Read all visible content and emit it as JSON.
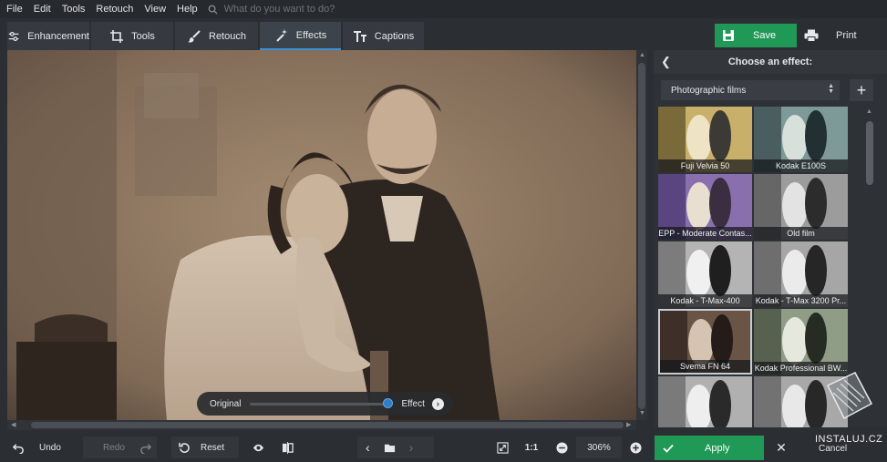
{
  "menu": {
    "items": [
      "File",
      "Edit",
      "Tools",
      "Retouch",
      "View",
      "Help"
    ],
    "search_placeholder": "What do you want to do?"
  },
  "tabs": [
    {
      "label": "Enhancement",
      "icon": "sliders-icon"
    },
    {
      "label": "Tools",
      "icon": "crop-icon"
    },
    {
      "label": "Retouch",
      "icon": "brush-icon"
    },
    {
      "label": "Effects",
      "icon": "magic-wand-icon",
      "active": true
    },
    {
      "label": "Captions",
      "icon": "text-icon"
    }
  ],
  "toolbar": {
    "save_label": "Save",
    "print_label": "Print"
  },
  "compare": {
    "original_label": "Original",
    "effect_label": "Effect",
    "slider_value": 1.0
  },
  "panel": {
    "title": "Choose an effect:",
    "category": "Photographic films",
    "effects": [
      {
        "label": "Fuji Velvia 50"
      },
      {
        "label": "Kodak E100S"
      },
      {
        "label": "EPP - Moderate Contas..."
      },
      {
        "label": "Old film"
      },
      {
        "label": "Kodak - T-Max-400"
      },
      {
        "label": "Kodak - T-Max 3200 Pr..."
      },
      {
        "label": "Svema FN 64",
        "selected": true
      },
      {
        "label": "Kodak Professional BW..."
      },
      {
        "label": ""
      },
      {
        "label": ""
      }
    ]
  },
  "bottom": {
    "undo_label": "Undo",
    "redo_label": "Redo",
    "reset_label": "Reset",
    "zoom_fit": "1:1",
    "zoom_level": "306%",
    "apply_label": "Apply",
    "cancel_label": "Cancel"
  },
  "watermark": "INSTALUJ.CZ",
  "colors": {
    "accent_green": "#1f9955",
    "accent_blue": "#3b8fd9",
    "background": "#2b2e33"
  }
}
